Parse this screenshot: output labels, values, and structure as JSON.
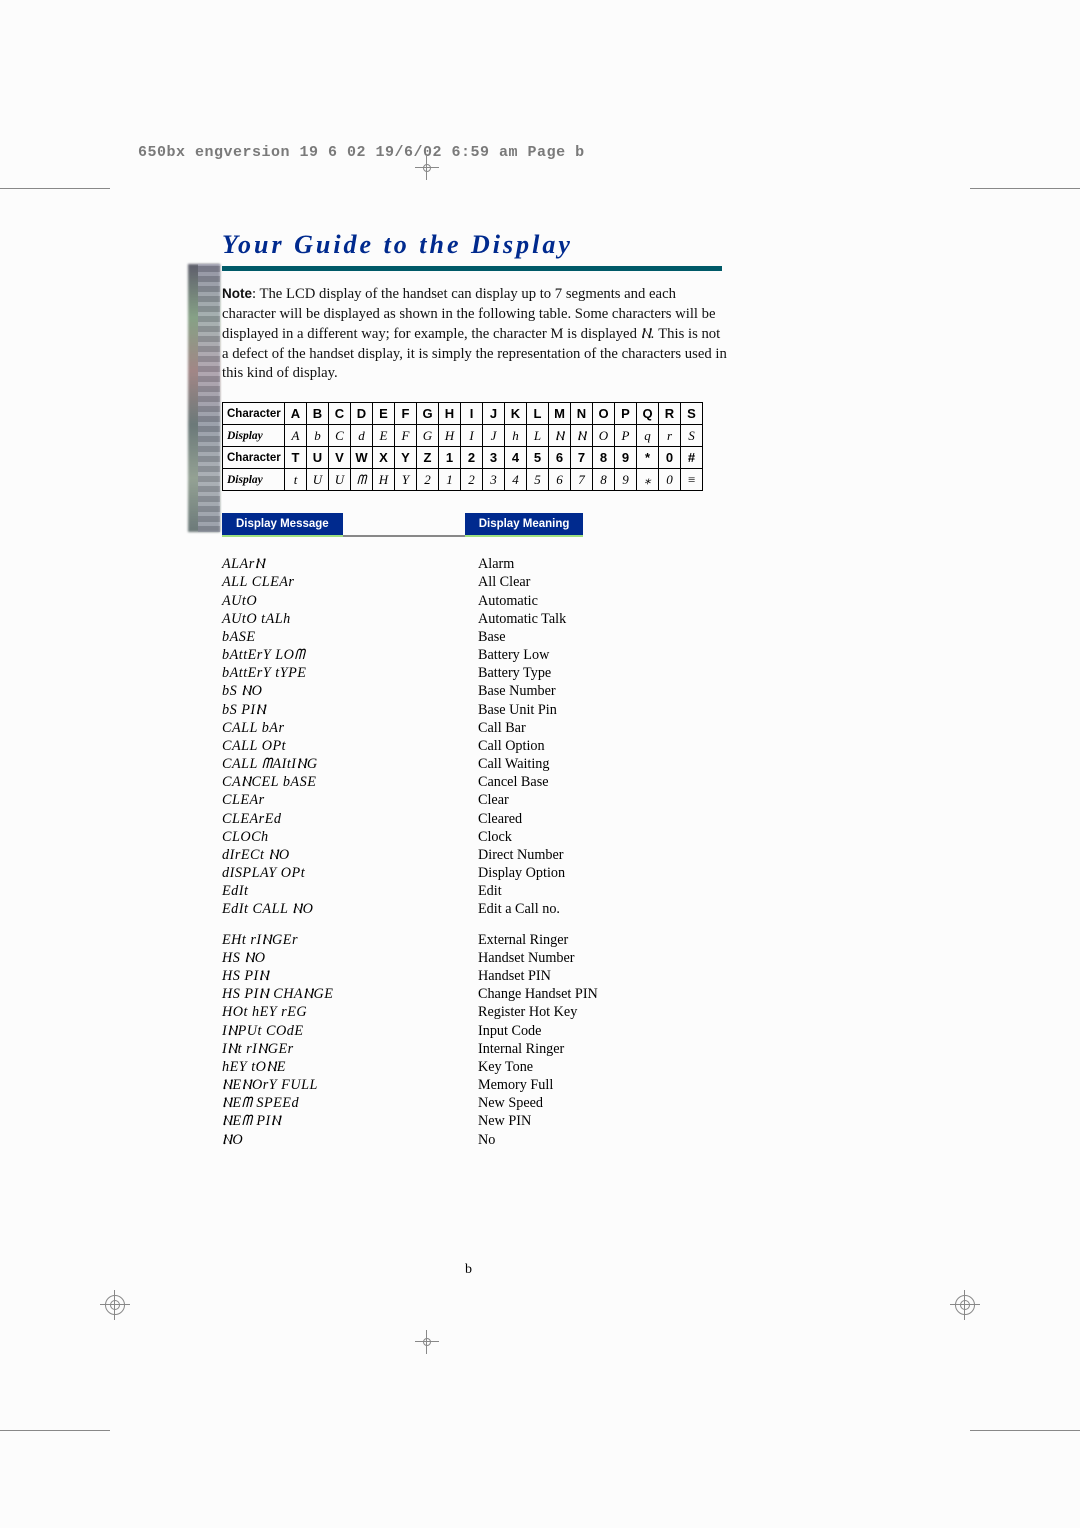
{
  "meta": {
    "header_text": "650bx engversion 19 6 02  19/6/02  6:59 am  Page b"
  },
  "title": "Your Guide to the Display",
  "note": {
    "label": "Note",
    "body": ": The LCD display of the handset can display up to 7 segments and each character will be displayed as shown in the following table. Some characters will be displayed in a different way; for example, the character M is displayed ",
    "example_glyph": "Ⲛ.",
    "body2": " This is not a defect of the handset display, it is simply the representation of the characters used in this kind of display."
  },
  "charmap": {
    "row_label_char": "Character",
    "row_label_disp": "Display",
    "r1_chars": [
      "A",
      "B",
      "C",
      "D",
      "E",
      "F",
      "G",
      "H",
      "I",
      "J",
      "K",
      "L",
      "M",
      "N",
      "O",
      "P",
      "Q",
      "R",
      "S"
    ],
    "r1_disp": [
      "A",
      "b",
      "C",
      "d",
      "E",
      "F",
      "G",
      "H",
      "I",
      "J",
      "h",
      "L",
      "Ⲛ",
      "Ⲛ",
      "O",
      "P",
      "q",
      "r",
      "S"
    ],
    "r2_chars": [
      "T",
      "U",
      "V",
      "W",
      "X",
      "Y",
      "Z",
      "1",
      "2",
      "3",
      "4",
      "5",
      "6",
      "7",
      "8",
      "9",
      "*",
      "0",
      "#"
    ],
    "r2_disp": [
      "t",
      "U",
      "U",
      "ᗰ",
      "H",
      "Y",
      "2",
      "1",
      "2",
      "3",
      "4",
      "5",
      "6",
      "7",
      "8",
      "9",
      "⁎",
      "0",
      "≡"
    ]
  },
  "headings": {
    "display_message": "Display Message",
    "display_meaning": "Display Meaning"
  },
  "definitions": [
    {
      "dm": "ALArⲚ",
      "mean": "Alarm"
    },
    {
      "dm": "ALL CLEAr",
      "mean": "All Clear"
    },
    {
      "dm": "AUtO",
      "mean": "Automatic"
    },
    {
      "dm": "AUtO tALh",
      "mean": "Automatic Talk"
    },
    {
      "dm": "bASE",
      "mean": "Base"
    },
    {
      "dm": "bAttErY LOᗰ",
      "mean": "Battery Low"
    },
    {
      "dm": "bAttErY tYPE",
      "mean": "Battery Type"
    },
    {
      "dm": "bS ⲚO",
      "mean": "Base Number"
    },
    {
      "dm": "bS PIⲚ",
      "mean": "Base Unit Pin"
    },
    {
      "dm": "CALL bAr",
      "mean": "Call Bar"
    },
    {
      "dm": "CALL OPt",
      "mean": "Call Option"
    },
    {
      "dm": "CALL ᗰAItIⲚG",
      "mean": "Call Waiting"
    },
    {
      "dm": "CAⲚCEL bASE",
      "mean": "Cancel Base"
    },
    {
      "dm": "CLEAr",
      "mean": "Clear"
    },
    {
      "dm": "CLEArEd",
      "mean": "Cleared"
    },
    {
      "dm": "CLOCh",
      "mean": "Clock"
    },
    {
      "dm": "dIrECt ⲚO",
      "mean": "Direct Number"
    },
    {
      "dm": "dISPLAY OPt",
      "mean": "Display Option"
    },
    {
      "dm": "EdIt",
      "mean": "Edit"
    },
    {
      "dm": "EdIt CALL ⲚO",
      "mean": "Edit a Call no."
    }
  ],
  "definitions2": [
    {
      "dm": "EHt rIⲚGEr",
      "mean": "External Ringer"
    },
    {
      "dm": "HS ⲚO",
      "mean": "Handset Number"
    },
    {
      "dm": "HS PIⲚ",
      "mean": "Handset PIN"
    },
    {
      "dm": "HS PIⲚ CHAⲚGE",
      "mean": "Change Handset PIN"
    },
    {
      "dm": "HOt hEY rEG",
      "mean": "Register Hot Key"
    },
    {
      "dm": "IⲚPUt COdE",
      "mean": "Input Code"
    },
    {
      "dm": "IⲚt rIⲚGEr",
      "mean": "Internal Ringer"
    },
    {
      "dm": "hEY tOⲚE",
      "mean": "Key Tone"
    },
    {
      "dm": "ⲚEⲚOrY FULL",
      "mean": "Memory Full"
    },
    {
      "dm": "ⲚEᗰ SPEEd",
      "mean": "New Speed"
    },
    {
      "dm": "ⲚEᗰ PIⲚ",
      "mean": "New PIN"
    },
    {
      "dm": "ⲚO",
      "mean": "No"
    }
  ],
  "page_number": "b"
}
